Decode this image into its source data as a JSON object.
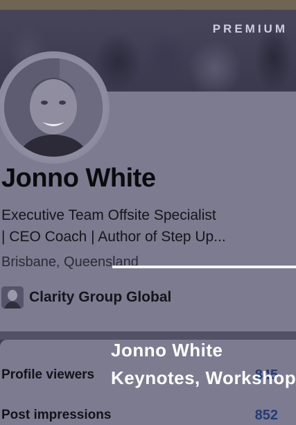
{
  "banner": {
    "badge": "PREMIUM"
  },
  "profile": {
    "name": "Jonno White",
    "headline_line1": "Executive Team Offsite Specialist",
    "headline_line2": "| CEO Coach | Author of Step Up...",
    "location": "Brisbane, Queensland",
    "company": "Clarity Group Global"
  },
  "stats": {
    "profile_viewers_label": "Profile viewers",
    "profile_viewers_value": "845",
    "post_impressions_label": "Post impressions",
    "post_impressions_value": "852"
  },
  "overlay": {
    "title": "Jonno White",
    "subtitle": "Keynotes, Workshops"
  },
  "colors": {
    "accent_value": "#213c75",
    "divider": "#f4f3f8"
  }
}
